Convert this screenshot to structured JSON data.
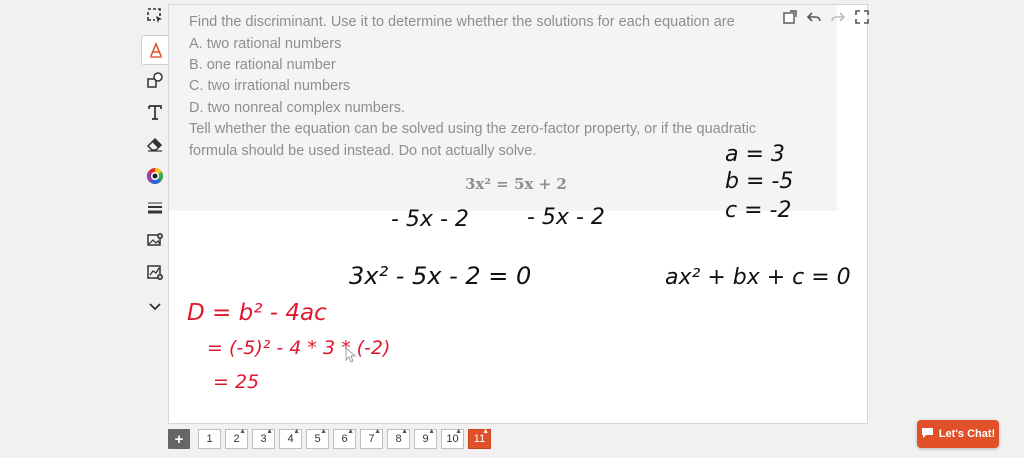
{
  "toolbar": {
    "tools": [
      {
        "icon": "select-region-icon"
      },
      {
        "icon": "pen-icon",
        "active": true
      },
      {
        "icon": "shapes-icon"
      },
      {
        "icon": "text-tool-icon"
      },
      {
        "icon": "eraser-icon"
      },
      {
        "icon": "color-picker-icon"
      },
      {
        "icon": "line-width-icon"
      },
      {
        "icon": "insert-image-icon"
      },
      {
        "icon": "insert-graph-icon"
      },
      {
        "icon": "chevron-down-icon"
      }
    ]
  },
  "problem": {
    "lines": [
      "Find the discriminant. Use it to determine whether the solutions for each equation are",
      "A. two rational numbers",
      "B. one rational number",
      "C. two irrational numbers",
      "D. two nonreal complex numbers.",
      "Tell whether the equation can be solved using the zero-factor property, or if the quadratic",
      "formula should be used instead. Do not actually solve."
    ],
    "equation": "3x² = 5x + 2"
  },
  "handwriting": {
    "a_value": "a = 3",
    "b_value": "b = -5",
    "c_value": "c = -2",
    "subtract_left": "- 5x - 2",
    "subtract_right": "- 5x - 2",
    "standard_form": "3x² - 5x - 2 = 0",
    "general_form": "ax² + bx + c = 0",
    "discriminant_formula": "D = b² - 4ac",
    "substitution": "= (-5)² - 4 * 3 * (-2)",
    "result": "= 25"
  },
  "colors": {
    "accent": "#e0512a",
    "ink_black": "#111111",
    "ink_red": "#e0182d"
  },
  "pager": {
    "add_label": "+",
    "pages": [
      "1",
      "2",
      "3",
      "4",
      "5",
      "6",
      "7",
      "8",
      "9",
      "10",
      "11"
    ],
    "current": "11"
  },
  "chat": {
    "label": "Let's Chat!"
  }
}
